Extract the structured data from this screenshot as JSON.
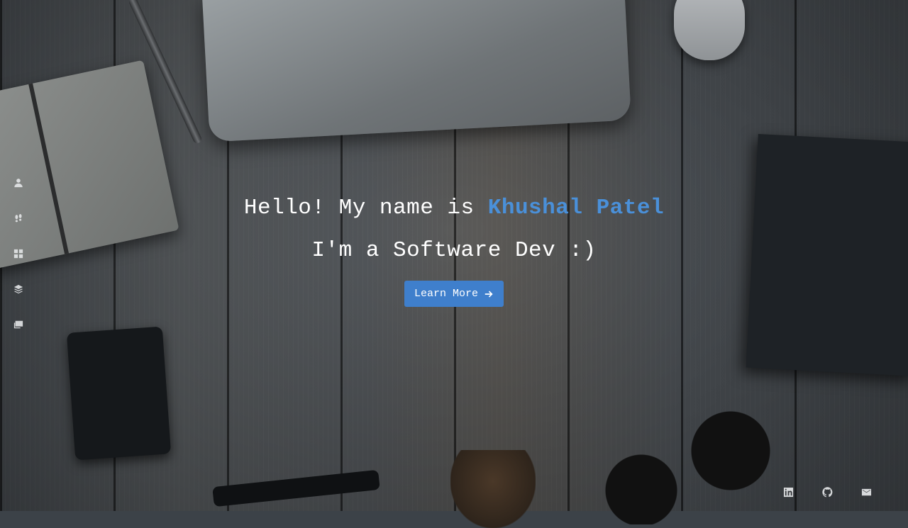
{
  "sidebar": {
    "items": [
      {
        "icon": "person-icon"
      },
      {
        "icon": "footprints-icon"
      },
      {
        "icon": "grid-icon"
      },
      {
        "icon": "layers-icon"
      },
      {
        "icon": "chat-icon"
      }
    ]
  },
  "hero": {
    "greeting": "Hello! My name is ",
    "name": "Khushal Patel",
    "tagline": "I'm a Software Dev :)",
    "cta_label": "Learn More",
    "cta_icon": "arrow-right-icon"
  },
  "social": {
    "items": [
      {
        "icon": "linkedin-icon"
      },
      {
        "icon": "github-icon"
      },
      {
        "icon": "mail-icon"
      }
    ]
  },
  "colors": {
    "accent": "#4a90d9",
    "button": "#3f7fcc",
    "text": "#ffffff"
  }
}
